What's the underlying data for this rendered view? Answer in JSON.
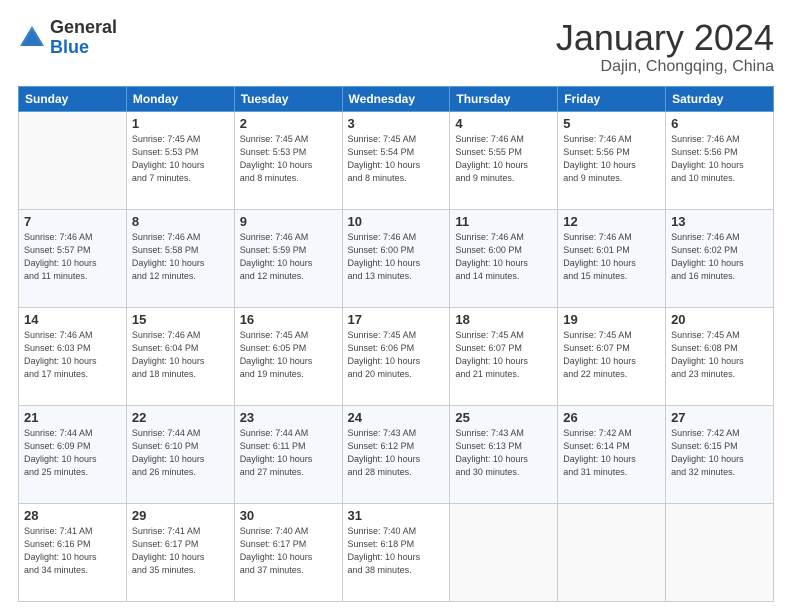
{
  "header": {
    "logo_general": "General",
    "logo_blue": "Blue",
    "month_title": "January 2024",
    "location": "Dajin, Chongqing, China"
  },
  "weekdays": [
    "Sunday",
    "Monday",
    "Tuesday",
    "Wednesday",
    "Thursday",
    "Friday",
    "Saturday"
  ],
  "weeks": [
    [
      {
        "day": "",
        "info": ""
      },
      {
        "day": "1",
        "info": "Sunrise: 7:45 AM\nSunset: 5:53 PM\nDaylight: 10 hours\nand 7 minutes."
      },
      {
        "day": "2",
        "info": "Sunrise: 7:45 AM\nSunset: 5:53 PM\nDaylight: 10 hours\nand 8 minutes."
      },
      {
        "day": "3",
        "info": "Sunrise: 7:45 AM\nSunset: 5:54 PM\nDaylight: 10 hours\nand 8 minutes."
      },
      {
        "day": "4",
        "info": "Sunrise: 7:46 AM\nSunset: 5:55 PM\nDaylight: 10 hours\nand 9 minutes."
      },
      {
        "day": "5",
        "info": "Sunrise: 7:46 AM\nSunset: 5:56 PM\nDaylight: 10 hours\nand 9 minutes."
      },
      {
        "day": "6",
        "info": "Sunrise: 7:46 AM\nSunset: 5:56 PM\nDaylight: 10 hours\nand 10 minutes."
      }
    ],
    [
      {
        "day": "7",
        "info": "Sunrise: 7:46 AM\nSunset: 5:57 PM\nDaylight: 10 hours\nand 11 minutes."
      },
      {
        "day": "8",
        "info": "Sunrise: 7:46 AM\nSunset: 5:58 PM\nDaylight: 10 hours\nand 12 minutes."
      },
      {
        "day": "9",
        "info": "Sunrise: 7:46 AM\nSunset: 5:59 PM\nDaylight: 10 hours\nand 12 minutes."
      },
      {
        "day": "10",
        "info": "Sunrise: 7:46 AM\nSunset: 6:00 PM\nDaylight: 10 hours\nand 13 minutes."
      },
      {
        "day": "11",
        "info": "Sunrise: 7:46 AM\nSunset: 6:00 PM\nDaylight: 10 hours\nand 14 minutes."
      },
      {
        "day": "12",
        "info": "Sunrise: 7:46 AM\nSunset: 6:01 PM\nDaylight: 10 hours\nand 15 minutes."
      },
      {
        "day": "13",
        "info": "Sunrise: 7:46 AM\nSunset: 6:02 PM\nDaylight: 10 hours\nand 16 minutes."
      }
    ],
    [
      {
        "day": "14",
        "info": "Sunrise: 7:46 AM\nSunset: 6:03 PM\nDaylight: 10 hours\nand 17 minutes."
      },
      {
        "day": "15",
        "info": "Sunrise: 7:46 AM\nSunset: 6:04 PM\nDaylight: 10 hours\nand 18 minutes."
      },
      {
        "day": "16",
        "info": "Sunrise: 7:45 AM\nSunset: 6:05 PM\nDaylight: 10 hours\nand 19 minutes."
      },
      {
        "day": "17",
        "info": "Sunrise: 7:45 AM\nSunset: 6:06 PM\nDaylight: 10 hours\nand 20 minutes."
      },
      {
        "day": "18",
        "info": "Sunrise: 7:45 AM\nSunset: 6:07 PM\nDaylight: 10 hours\nand 21 minutes."
      },
      {
        "day": "19",
        "info": "Sunrise: 7:45 AM\nSunset: 6:07 PM\nDaylight: 10 hours\nand 22 minutes."
      },
      {
        "day": "20",
        "info": "Sunrise: 7:45 AM\nSunset: 6:08 PM\nDaylight: 10 hours\nand 23 minutes."
      }
    ],
    [
      {
        "day": "21",
        "info": "Sunrise: 7:44 AM\nSunset: 6:09 PM\nDaylight: 10 hours\nand 25 minutes."
      },
      {
        "day": "22",
        "info": "Sunrise: 7:44 AM\nSunset: 6:10 PM\nDaylight: 10 hours\nand 26 minutes."
      },
      {
        "day": "23",
        "info": "Sunrise: 7:44 AM\nSunset: 6:11 PM\nDaylight: 10 hours\nand 27 minutes."
      },
      {
        "day": "24",
        "info": "Sunrise: 7:43 AM\nSunset: 6:12 PM\nDaylight: 10 hours\nand 28 minutes."
      },
      {
        "day": "25",
        "info": "Sunrise: 7:43 AM\nSunset: 6:13 PM\nDaylight: 10 hours\nand 30 minutes."
      },
      {
        "day": "26",
        "info": "Sunrise: 7:42 AM\nSunset: 6:14 PM\nDaylight: 10 hours\nand 31 minutes."
      },
      {
        "day": "27",
        "info": "Sunrise: 7:42 AM\nSunset: 6:15 PM\nDaylight: 10 hours\nand 32 minutes."
      }
    ],
    [
      {
        "day": "28",
        "info": "Sunrise: 7:41 AM\nSunset: 6:16 PM\nDaylight: 10 hours\nand 34 minutes."
      },
      {
        "day": "29",
        "info": "Sunrise: 7:41 AM\nSunset: 6:17 PM\nDaylight: 10 hours\nand 35 minutes."
      },
      {
        "day": "30",
        "info": "Sunrise: 7:40 AM\nSunset: 6:17 PM\nDaylight: 10 hours\nand 37 minutes."
      },
      {
        "day": "31",
        "info": "Sunrise: 7:40 AM\nSunset: 6:18 PM\nDaylight: 10 hours\nand 38 minutes."
      },
      {
        "day": "",
        "info": ""
      },
      {
        "day": "",
        "info": ""
      },
      {
        "day": "",
        "info": ""
      }
    ]
  ]
}
